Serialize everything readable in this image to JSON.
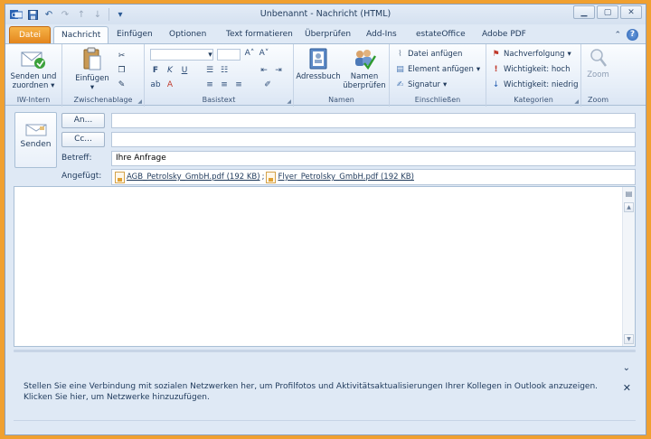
{
  "window": {
    "title": "Unbenannt - Nachricht (HTML)"
  },
  "tabs": [
    {
      "label": "Datei"
    },
    {
      "label": "Nachricht"
    },
    {
      "label": "Einfügen"
    },
    {
      "label": "Optionen"
    },
    {
      "label": "Text formatieren"
    },
    {
      "label": "Überprüfen"
    },
    {
      "label": "Add-Ins"
    },
    {
      "label": "estateOffice"
    },
    {
      "label": "Adobe PDF"
    }
  ],
  "ribbon": {
    "iw": {
      "button_line1": "Senden und",
      "button_line2": "zuordnen",
      "group_label": "IW-Intern"
    },
    "clipboard": {
      "paste_label": "Einfügen",
      "group_label": "Zwischenablage"
    },
    "basictext": {
      "group_label": "Basistext"
    },
    "names": {
      "addressbook_label": "Adressbuch",
      "check_line1": "Namen",
      "check_line2": "überprüfen",
      "group_label": "Namen"
    },
    "include": {
      "attach_file": "Datei anfügen",
      "attach_item": "Element anfügen",
      "signature": "Signatur",
      "group_label": "Einschließen"
    },
    "tags": {
      "followup": "Nachverfolgung",
      "high": "Wichtigkeit: hoch",
      "low": "Wichtigkeit: niedrig",
      "group_label": "Kategorien"
    },
    "zoom": {
      "button_label": "Zoom",
      "group_label": "Zoom"
    }
  },
  "compose": {
    "send_label": "Senden",
    "to_button": "An...",
    "cc_button": "Cc...",
    "to_value": "",
    "cc_value": "",
    "subject_label": "Betreff:",
    "subject_value": "Ihre Anfrage",
    "attached_label": "Angefügt:",
    "attachments": [
      {
        "name": "AGB_Petrolsky_GmbH.pdf (192 KB)"
      },
      {
        "name": "Flyer_Petrolsky_GmbH.pdf (192 KB)"
      }
    ],
    "attachment_separator": ";"
  },
  "social": {
    "message": "Stellen Sie eine Verbindung mit sozialen Netzwerken her, um Profilfotos und Aktivitätsaktualisierungen Ihrer Kollegen in Outlook anzuzeigen. Klicken Sie hier, um Netzwerke hinzuzufügen."
  },
  "colors": {
    "frame": "#f0a030",
    "file_tab": "#e2831b",
    "ribbon_text": "#1e395b"
  }
}
